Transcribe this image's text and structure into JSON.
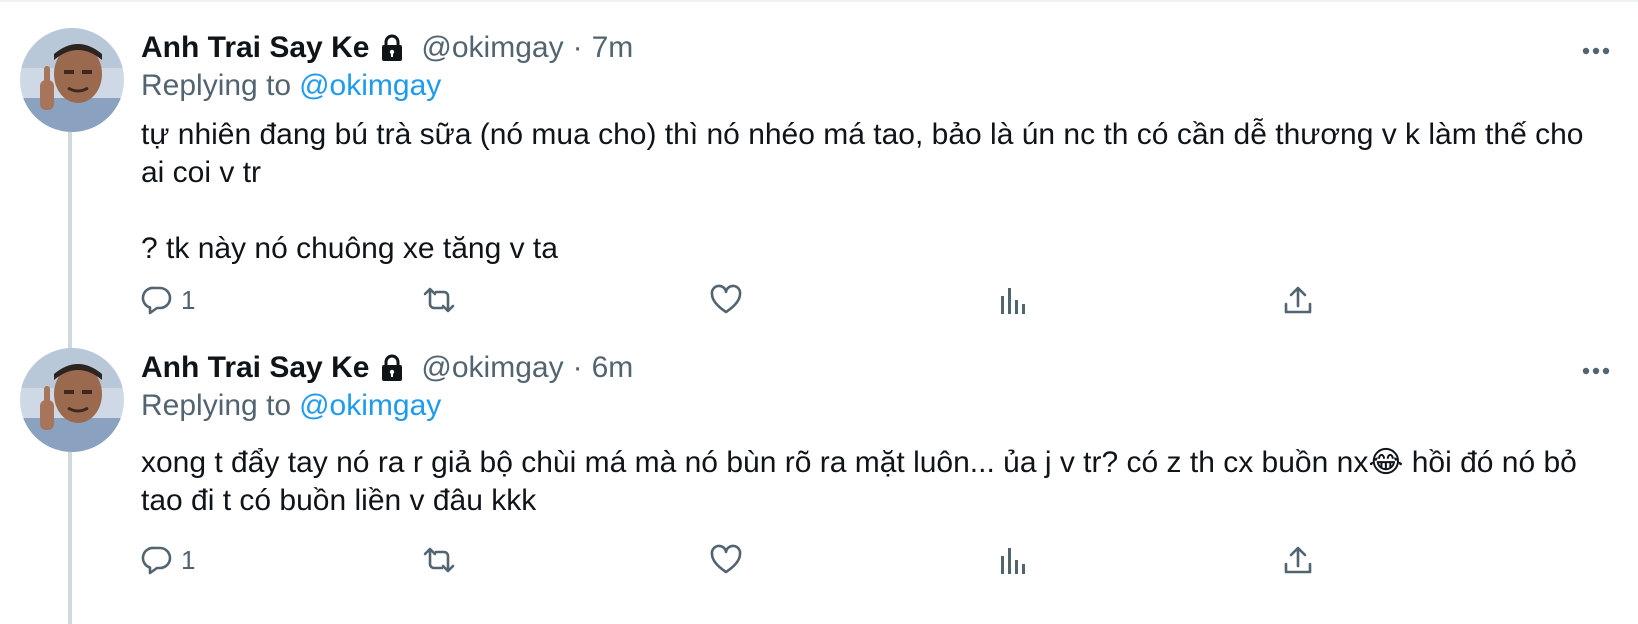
{
  "tweets": [
    {
      "display_name": "Anh Trai Say Ke",
      "handle": "@okimgay",
      "separator": "·",
      "time": "7m",
      "replying_label": "Replying to",
      "replying_to": "@okimgay",
      "paragraphs": [
        "tự nhiên đang bú trà sữa (nó mua cho) thì nó nhéo má tao, bảo là ún nc th có cần dễ thương v k làm thế cho ai coi v tr",
        "? tk này nó chuông xe tăng v ta"
      ],
      "reply_count": "1",
      "icons": [
        "lock-icon",
        "more-icon",
        "reply-icon",
        "retweet-icon",
        "like-icon",
        "views-icon",
        "share-icon"
      ]
    },
    {
      "display_name": "Anh Trai Say Ke",
      "handle": "@okimgay",
      "separator": "·",
      "time": "6m",
      "replying_label": "Replying to",
      "replying_to": "@okimgay",
      "paragraphs": [
        "xong t đẩy tay nó ra r giả bộ chùi má mà nó bùn rõ ra mặt luôn... ủa j v tr? có z th cx buồn nx😂  hồi đó nó bỏ tao đi t có buồn liền v đâu kkk"
      ],
      "reply_count": "1",
      "icons": [
        "lock-icon",
        "more-icon",
        "reply-icon",
        "retweet-icon",
        "like-icon",
        "views-icon",
        "share-icon"
      ]
    }
  ],
  "colors": {
    "text": "#0f1419",
    "secondary": "#536471",
    "link": "#1d9bf0",
    "thread_line": "#cfd9de"
  }
}
